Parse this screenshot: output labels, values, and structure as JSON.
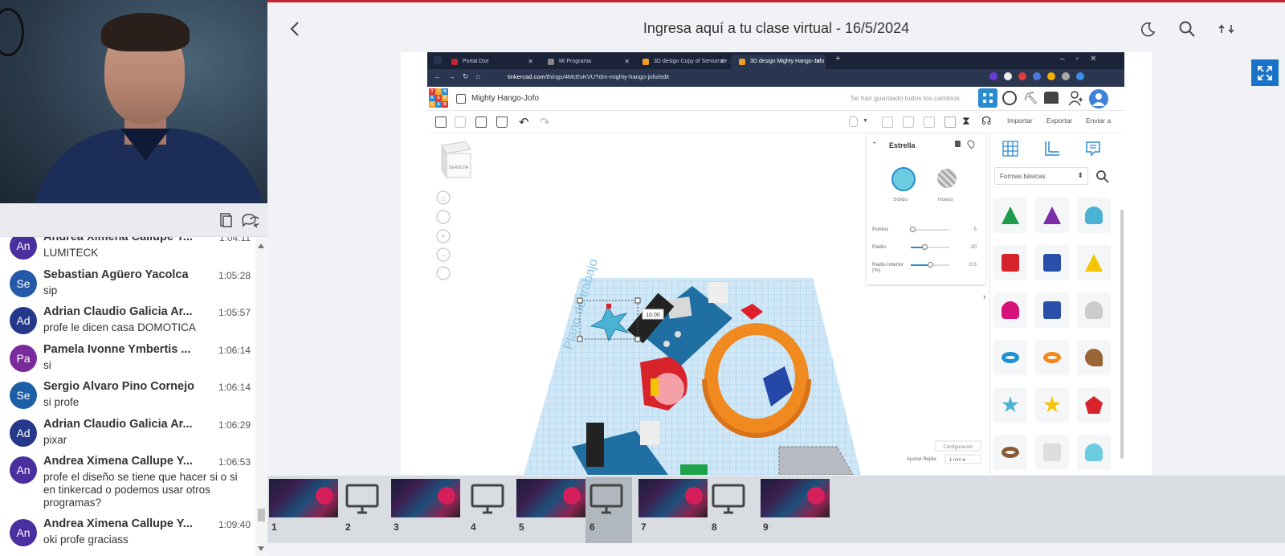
{
  "header": {
    "title": "Ingresa aquí a tu clase virtual - 16/5/2024"
  },
  "chat": {
    "messages": [
      {
        "initials": "An",
        "color": "#4a2f9f",
        "name": "Andrea Ximena Callupe Y...",
        "time": "1:04:11",
        "text": "LUMITECK"
      },
      {
        "initials": "Se",
        "color": "#2559a8",
        "name": "Sebastian Agüero Yacolca",
        "time": "1:05:28",
        "text": "sip"
      },
      {
        "initials": "Ad",
        "color": "#25388a",
        "name": "Adrian Claudio Galicia Ar...",
        "time": "1:05:57",
        "text": "profe le dicen casa DOMOTICA"
      },
      {
        "initials": "Pa",
        "color": "#7a2b9b",
        "name": "Pamela Ivonne Ymbertis ...",
        "time": "1:06:14",
        "text": "si"
      },
      {
        "initials": "Se",
        "color": "#1d5fa6",
        "name": "Sergio Alvaro Pino Cornejo",
        "time": "1:06:14",
        "text": "si profe"
      },
      {
        "initials": "Ad",
        "color": "#25388a",
        "name": "Adrian Claudio Galicia Ar...",
        "time": "1:06:29",
        "text": "pixar"
      },
      {
        "initials": "An",
        "color": "#4a2f9f",
        "name": "Andrea Ximena Callupe Y...",
        "time": "1:06:53",
        "text": "profe el diseño se tiene que hacer si o si en tinkercad o podemos usar otros programas?"
      },
      {
        "initials": "An",
        "color": "#4a2f9f",
        "name": "Andrea Ximena Callupe Y...",
        "time": "1:09:40",
        "text": "oki profe graciass"
      }
    ]
  },
  "browser": {
    "tabs": [
      {
        "label": "Portal Dse",
        "color": "#c0262d"
      },
      {
        "label": "Mi Programa",
        "color": "#888"
      },
      {
        "label": "3D design Copy of Sensor de ...",
        "color": "#f0a020"
      },
      {
        "label": "3D design Mighty Hango-Jofo",
        "color": "#f0a020"
      }
    ],
    "url_host": "tinkercad.com",
    "url_path": "/things/4McEvKVUTdm-mighty-hango-jofo/edit"
  },
  "tinkercad": {
    "logo_letters": [
      "T",
      "I",
      "N",
      "K",
      "E",
      "R",
      "C",
      "A",
      "D"
    ],
    "design_name": "Mighty Hango-Jofo",
    "saved_status": "Se han guardado todos los cambios.",
    "import_label": "Importar",
    "export_label": "Exportar",
    "send_label": "Enviar a",
    "viewcube_label": "DERECHA",
    "workplane_label": "Plano de trabajo",
    "dimension_label": "10.00",
    "props": {
      "shape_name": "Estrella",
      "solid_label": "Sólido",
      "hole_label": "Hueco",
      "params": [
        {
          "label": "Puntos",
          "value": "5",
          "level": 0.05
        },
        {
          "label": "Radio",
          "value": "20",
          "level": 0.35
        },
        {
          "label": "Radio Interior (%)",
          "value": "0.5",
          "level": 0.5
        }
      ]
    },
    "shapes_category": "Formas básicas",
    "config_label": "Configuración",
    "grid_label": "Ajustar Rejilla",
    "grid_value": "1 mm"
  },
  "thumbs": [
    {
      "num": "1",
      "kind": "image"
    },
    {
      "num": "2",
      "kind": "monitor"
    },
    {
      "num": "3",
      "kind": "image"
    },
    {
      "num": "4",
      "kind": "monitor"
    },
    {
      "num": "5",
      "kind": "image"
    },
    {
      "num": "6",
      "kind": "monitor",
      "selected": true
    },
    {
      "num": "7",
      "kind": "image"
    },
    {
      "num": "8",
      "kind": "monitor"
    },
    {
      "num": "9",
      "kind": "image"
    }
  ],
  "colors": {
    "accent": "#c0262d",
    "fullscreen": "#1a73c9",
    "tinkercad_blue": "#2a8ccf"
  }
}
